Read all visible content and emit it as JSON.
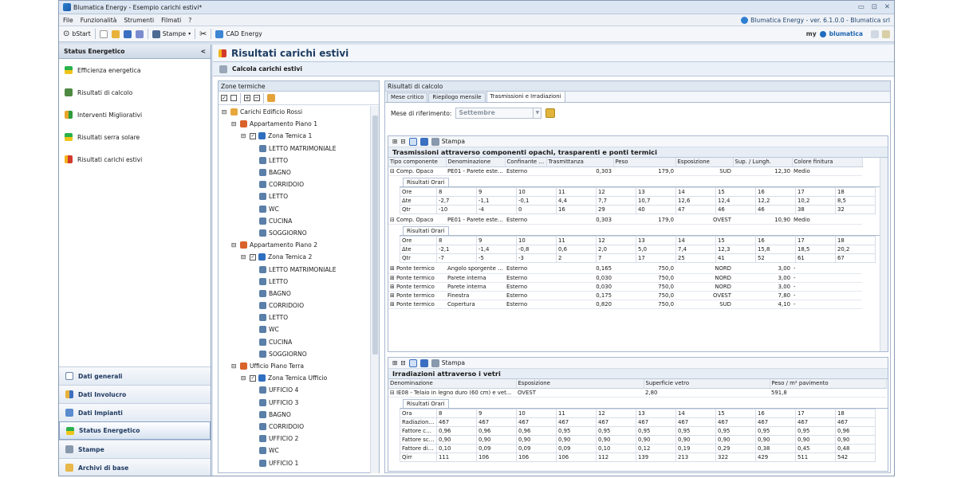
{
  "window": {
    "title": "Blumatica Energy - Esempio carichi estivi*",
    "version": "Blumatica Energy - ver. 6.1.0.0 - Blumatica srl"
  },
  "menu": [
    "File",
    "Funzionalità",
    "Strumenti",
    "Filmati",
    "?"
  ],
  "toolbar": {
    "start": "bStart",
    "print": "Stampe",
    "cad": "CAD Energy",
    "brand_my": "my",
    "brand": "blumatica"
  },
  "left": {
    "title": "Status Energetico",
    "collapse": "<",
    "items": [
      "Efficienza energetica",
      "Risultati di calcolo",
      "Interventi Migliorativi",
      "Risultati serra solare",
      "Risultati carichi estivi"
    ],
    "nav": [
      "Dati generali",
      "Dati Involucro",
      "Dati Impianti",
      "Status Energetico",
      "Stampe",
      "Archivi di base"
    ]
  },
  "content": {
    "title": "Risultati carichi estivi",
    "subtitle": "Calcola carichi estivi"
  },
  "zones": {
    "header": "Zone termiche",
    "tree": [
      {
        "l": 0,
        "t": "Carichi Edificio Rossi",
        "k": "root"
      },
      {
        "l": 1,
        "t": "Appartamento Piano 1",
        "k": "unit"
      },
      {
        "l": 2,
        "t": "Zona Temica 1",
        "k": "zone"
      },
      {
        "l": 3,
        "t": "LETTO MATRIMONIALE",
        "k": "room"
      },
      {
        "l": 3,
        "t": "LETTO",
        "k": "room"
      },
      {
        "l": 3,
        "t": "BAGNO",
        "k": "room"
      },
      {
        "l": 3,
        "t": "CORRIDOIO",
        "k": "room"
      },
      {
        "l": 3,
        "t": "LETTO",
        "k": "room"
      },
      {
        "l": 3,
        "t": "WC",
        "k": "room"
      },
      {
        "l": 3,
        "t": "CUCINA",
        "k": "room"
      },
      {
        "l": 3,
        "t": "SOGGIORNO",
        "k": "room"
      },
      {
        "l": 1,
        "t": "Appartamento Piano 2",
        "k": "unit"
      },
      {
        "l": 2,
        "t": "Zona Temica 2",
        "k": "zone"
      },
      {
        "l": 3,
        "t": "LETTO MATRIMONIALE",
        "k": "room"
      },
      {
        "l": 3,
        "t": "LETTO",
        "k": "room"
      },
      {
        "l": 3,
        "t": "BAGNO",
        "k": "room"
      },
      {
        "l": 3,
        "t": "CORRIDOIO",
        "k": "room"
      },
      {
        "l": 3,
        "t": "LETTO",
        "k": "room"
      },
      {
        "l": 3,
        "t": "WC",
        "k": "room"
      },
      {
        "l": 3,
        "t": "CUCINA",
        "k": "room"
      },
      {
        "l": 3,
        "t": "SOGGIORNO",
        "k": "room"
      },
      {
        "l": 1,
        "t": "Ufficio Piano Terra",
        "k": "unit"
      },
      {
        "l": 2,
        "t": "Zona Temica Ufficio",
        "k": "zone"
      },
      {
        "l": 3,
        "t": "UFFICIO 4",
        "k": "room"
      },
      {
        "l": 3,
        "t": "UFFICIO 3",
        "k": "room"
      },
      {
        "l": 3,
        "t": "BAGNO",
        "k": "room"
      },
      {
        "l": 3,
        "t": "CORRIDOIO",
        "k": "room"
      },
      {
        "l": 3,
        "t": "UFFICIO 2",
        "k": "room"
      },
      {
        "l": 3,
        "t": "WC",
        "k": "room"
      },
      {
        "l": 3,
        "t": "UFFICIO 1",
        "k": "room"
      }
    ]
  },
  "results": {
    "header": "Risultati di calcolo",
    "tabs": [
      "Mese critico",
      "Riepilogo mensile",
      "Trasmissioni e Irradiazioni"
    ],
    "month_label": "Mese di riferimento:",
    "month": "Settembre",
    "print": "Stampa",
    "trasm": {
      "title": "Trasmissioni attraverso componenti opachi, trasparenti e ponti termici",
      "cols": [
        "Tipo componente",
        "Denominazione",
        "Confinante con",
        "Trasmittanza",
        "Peso",
        "Esposizione",
        "Sup. / Lungh.",
        "Colore finitura"
      ],
      "detail_tab": "Risultati Orari",
      "components": [
        {
          "row": [
            "Comp. Opaco",
            "PE01 - Parete este...",
            "Esterno",
            "0,303",
            "179,0",
            "SUD",
            "12,30",
            "Medio"
          ],
          "hours": [
            [
              "Ore",
              "8",
              "9",
              "10",
              "11",
              "12",
              "13",
              "14",
              "15",
              "16",
              "17",
              "18"
            ],
            [
              "Δte",
              "-2,7",
              "-1,1",
              "-0,1",
              "4,4",
              "7,7",
              "10,7",
              "12,6",
              "12,4",
              "12,2",
              "10,2",
              "8,5"
            ],
            [
              "Qtr",
              "-10",
              "-4",
              "0",
              "16",
              "29",
              "40",
              "47",
              "46",
              "46",
              "38",
              "32"
            ]
          ]
        },
        {
          "row": [
            "Comp. Opaco",
            "PE01 - Parete este...",
            "Esterno",
            "0,303",
            "179,0",
            "OVEST",
            "10,90",
            "Medio"
          ],
          "hours": [
            [
              "Ore",
              "8",
              "9",
              "10",
              "11",
              "12",
              "13",
              "14",
              "15",
              "16",
              "17",
              "18"
            ],
            [
              "Δte",
              "-2,1",
              "-1,4",
              "-0,8",
              "0,6",
              "2,0",
              "5,0",
              "7,4",
              "12,3",
              "15,8",
              "18,5",
              "20,2"
            ],
            [
              "Qtr",
              "-7",
              "-5",
              "-3",
              "2",
              "7",
              "17",
              "25",
              "41",
              "52",
              "61",
              "67"
            ]
          ]
        }
      ],
      "bridges": [
        [
          "Ponte termico",
          "Angolo sporgente s...",
          "Esterno",
          "0,165",
          "750,0",
          "NORD",
          "3,00",
          "-"
        ],
        [
          "Ponte termico",
          "Parete interna",
          "Esterno",
          "0,030",
          "750,0",
          "NORD",
          "3,00",
          "-"
        ],
        [
          "Ponte termico",
          "Parete interna",
          "Esterno",
          "0,030",
          "750,0",
          "NORD",
          "3,00",
          "-"
        ],
        [
          "Ponte termico",
          "Finestra",
          "Esterno",
          "0,175",
          "750,0",
          "OVEST",
          "7,80",
          "-"
        ],
        [
          "Ponte termico",
          "Copertura",
          "Esterno",
          "0,820",
          "750,0",
          "SUD",
          "4,10",
          "-"
        ]
      ]
    },
    "irr": {
      "title": "Irradiazioni attraverso i vetri",
      "cols": [
        "Denominazione",
        "Esposizione",
        "Superficie vetro",
        "Peso / m² pavimento"
      ],
      "row": [
        "IE08 - Telaio in legno duro (60 cm) e vet...",
        "OVEST",
        "2,80",
        "591,8"
      ],
      "detail_tab": "Risultati Orari",
      "hours": [
        [
          "Ora",
          "8",
          "9",
          "10",
          "11",
          "12",
          "13",
          "14",
          "15",
          "16",
          "17",
          "18"
        ],
        [
          "Radiazione ...",
          "467",
          "467",
          "467",
          "467",
          "467",
          "467",
          "467",
          "467",
          "467",
          "467",
          "467"
        ],
        [
          "Fattore cor...",
          "0,96",
          "0,96",
          "0,96",
          "0,95",
          "0,95",
          "0,95",
          "0,95",
          "0,95",
          "0,95",
          "0,95",
          "0,96"
        ],
        [
          "Fattore sch...",
          "0,90",
          "0,90",
          "0,90",
          "0,90",
          "0,90",
          "0,90",
          "0,90",
          "0,90",
          "0,90",
          "0,90",
          "0,90"
        ],
        [
          "Fattore di ...",
          "0,10",
          "0,09",
          "0,09",
          "0,09",
          "0,10",
          "0,12",
          "0,19",
          "0,29",
          "0,38",
          "0,45",
          "0,48"
        ],
        [
          "Qirr",
          "111",
          "106",
          "106",
          "106",
          "112",
          "139",
          "213",
          "322",
          "429",
          "511",
          "542"
        ]
      ]
    }
  }
}
